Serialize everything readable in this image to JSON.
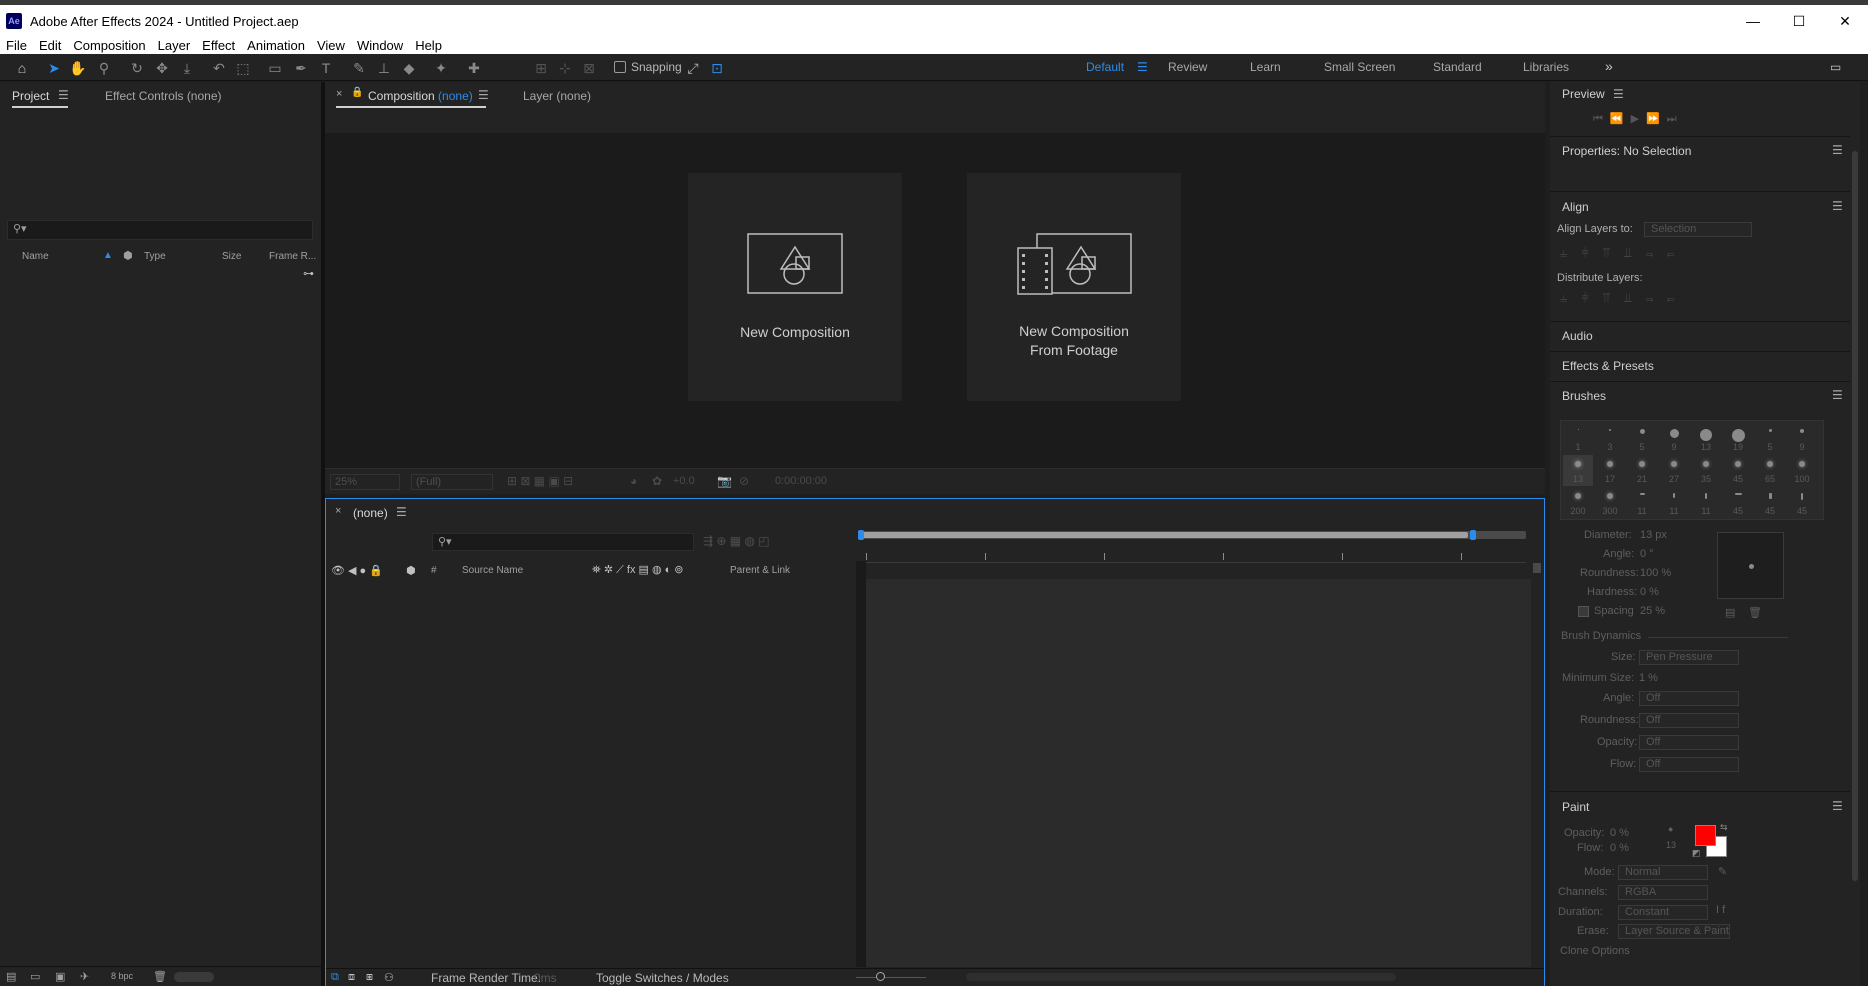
{
  "window": {
    "title": "Adobe After Effects 2024 - Untitled Project.aep",
    "logo": "Ae",
    "minimize": "—",
    "maximize": "☐",
    "close": "✕"
  },
  "menu": [
    "File",
    "Edit",
    "Composition",
    "Layer",
    "Effect",
    "Animation",
    "View",
    "Window",
    "Help"
  ],
  "toolbar": {
    "snapping_label": "Snapping",
    "workspaces": [
      "Default",
      "Review",
      "Learn",
      "Small Screen",
      "Standard",
      "Libraries"
    ],
    "active_workspace": "Default",
    "overflow": "»"
  },
  "project_panel": {
    "tab_project": "Project",
    "tab_effect_controls": "Effect Controls (none)",
    "columns": [
      "Name",
      "Type",
      "Size",
      "Frame R..."
    ],
    "footer_bpc": "8 bpc"
  },
  "composition_panel": {
    "tab_composition_prefix": "Composition",
    "tab_composition_suffix": "(none)",
    "tab_layer": "Layer (none)",
    "card_new_comp": "New Composition",
    "card_new_comp_footage_line1": "New Composition",
    "card_new_comp_footage_line2": "From Footage",
    "footer": {
      "zoom": "25%",
      "resolution": "(Full)",
      "exposure": "+0.0",
      "timecode": "0:00:00:00"
    }
  },
  "timeline_panel": {
    "tab": "(none)",
    "columns": {
      "source_name": "Source Name",
      "parent_link": "Parent & Link",
      "hash": "#"
    },
    "frame_render_label": "Frame Render Time:",
    "frame_render_value": "0ms",
    "toggle_label": "Toggle Switches / Modes"
  },
  "preview_panel": {
    "title": "Preview"
  },
  "properties_panel": {
    "title": "Properties: No Selection"
  },
  "align_panel": {
    "title": "Align",
    "align_to_label": "Align Layers to:",
    "align_to_value": "Selection",
    "distribute_label": "Distribute Layers:"
  },
  "audio_panel": {
    "title": "Audio"
  },
  "effects_panel": {
    "title": "Effects & Presets"
  },
  "brushes_panel": {
    "title": "Brushes",
    "sizes": [
      [
        "1",
        "3",
        "5",
        "9",
        "13",
        "19",
        "5",
        "9"
      ],
      [
        "13",
        "17",
        "21",
        "27",
        "35",
        "45",
        "65",
        "100"
      ],
      [
        "200",
        "300",
        "11",
        "11",
        "11",
        "45",
        "45",
        "45"
      ]
    ],
    "diameter_label": "Diameter:",
    "diameter_value": "13 px",
    "angle_label": "Angle:",
    "angle_value": "0 °",
    "roundness_label": "Roundness:",
    "roundness_value": "100 %",
    "hardness_label": "Hardness:",
    "hardness_value": "0 %",
    "spacing_label": "Spacing",
    "spacing_value": "25 %",
    "dynamics_label": "Brush Dynamics",
    "size_label": "Size:",
    "size_value": "Pen Pressure",
    "min_size_label": "Minimum Size:",
    "min_size_value": "1 %",
    "dyn_angle_label": "Angle:",
    "dyn_angle_value": "Off",
    "dyn_roundness_label": "Roundness:",
    "dyn_roundness_value": "Off",
    "opacity_label": "Opacity:",
    "opacity_value": "Off",
    "flow_label": "Flow:",
    "flow_value": "Off"
  },
  "paint_panel": {
    "title": "Paint",
    "opacity_label": "Opacity:",
    "opacity_value": "0 %",
    "flow_label": "Flow:",
    "flow_value": "0 %",
    "brush_size": "13",
    "mode_label": "Mode:",
    "mode_value": "Normal",
    "channels_label": "Channels:",
    "channels_value": "RGBA",
    "duration_label": "Duration:",
    "duration_value": "Constant",
    "erase_label": "Erase:",
    "erase_value": "Layer Source & Paint",
    "clone_label": "Clone Options",
    "fg_color": "#ff0000",
    "bg_color": "#ffffff"
  },
  "colors": {
    "accent": "#2d8ceb"
  }
}
